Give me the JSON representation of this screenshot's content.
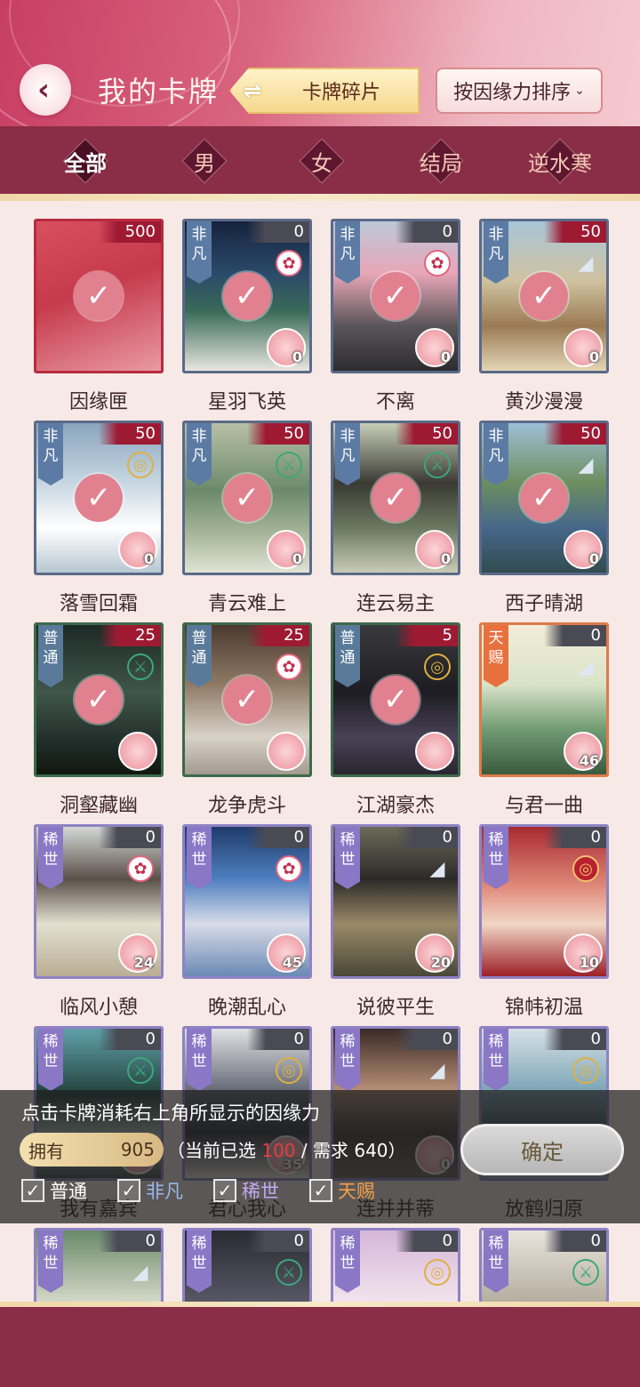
{
  "header": {
    "back_label": "‹",
    "title": "我的卡牌",
    "switch_label": "卡牌碎片",
    "sort_label": "按因缘力排序"
  },
  "tabs": [
    {
      "label": "全部",
      "active": true
    },
    {
      "label": "男"
    },
    {
      "label": "女"
    },
    {
      "label": "结局"
    },
    {
      "label": "逆水寒"
    }
  ],
  "cards": [
    {
      "name": "因缘匣",
      "cost": "500",
      "rarity": "",
      "elem": "",
      "selected": true,
      "owned": ""
    },
    {
      "name": "星羽飞英",
      "cost": "0",
      "rarity": "非凡",
      "elem": "flower",
      "selected": true,
      "owned": "0"
    },
    {
      "name": "不离",
      "cost": "0",
      "rarity": "非凡",
      "elem": "flower",
      "selected": true,
      "owned": "0"
    },
    {
      "name": "黄沙漫漫",
      "cost": "50",
      "rarity": "非凡",
      "elem": "fan",
      "selected": true,
      "owned": "0"
    },
    {
      "name": "落雪回霜",
      "cost": "50",
      "rarity": "非凡",
      "elem": "coin",
      "selected": true,
      "owned": "0"
    },
    {
      "name": "青云难上",
      "cost": "50",
      "rarity": "非凡",
      "elem": "sword",
      "selected": true,
      "owned": "0"
    },
    {
      "name": "连云易主",
      "cost": "50",
      "rarity": "非凡",
      "elem": "sword",
      "selected": true,
      "owned": "0"
    },
    {
      "name": "西子晴湖",
      "cost": "50",
      "rarity": "非凡",
      "elem": "fan",
      "selected": true,
      "owned": "0"
    },
    {
      "name": "洞壑藏幽",
      "cost": "25",
      "rarity": "普通",
      "elem": "sword",
      "selected": true,
      "owned": ""
    },
    {
      "name": "龙争虎斗",
      "cost": "25",
      "rarity": "普通",
      "elem": "flower",
      "selected": true,
      "owned": ""
    },
    {
      "name": "江湖豪杰",
      "cost": "5",
      "rarity": "普通",
      "elem": "coin",
      "selected": true,
      "owned": ""
    },
    {
      "name": "与君一曲",
      "cost": "0",
      "rarity": "天赐",
      "elem": "fan",
      "selected": false,
      "owned": "46"
    },
    {
      "name": "临风小憩",
      "cost": "0",
      "rarity": "稀世",
      "elem": "flower",
      "selected": false,
      "owned": "24"
    },
    {
      "name": "晚潮乱心",
      "cost": "0",
      "rarity": "稀世",
      "elem": "flower",
      "selected": false,
      "owned": "45"
    },
    {
      "name": "说彼平生",
      "cost": "0",
      "rarity": "稀世",
      "elem": "fan",
      "selected": false,
      "owned": "20"
    },
    {
      "name": "锦帏初温",
      "cost": "0",
      "rarity": "稀世",
      "elem": "coinred",
      "selected": false,
      "owned": "10"
    },
    {
      "name": "我有嘉宾",
      "cost": "0",
      "rarity": "稀世",
      "elem": "sword",
      "selected": false,
      "owned": ""
    },
    {
      "name": "君心我心",
      "cost": "0",
      "rarity": "稀世",
      "elem": "coin",
      "selected": false,
      "owned": "35"
    },
    {
      "name": "连并并蒂",
      "cost": "0",
      "rarity": "稀世",
      "elem": "fan",
      "selected": false,
      "owned": "0"
    },
    {
      "name": "放鹤归原",
      "cost": "0",
      "rarity": "稀世",
      "elem": "coin",
      "selected": false,
      "owned": ""
    },
    {
      "name": "",
      "cost": "0",
      "rarity": "稀世",
      "elem": "fan",
      "selected": false,
      "owned": ""
    },
    {
      "name": "",
      "cost": "0",
      "rarity": "稀世",
      "elem": "sword",
      "selected": false,
      "owned": ""
    },
    {
      "name": "",
      "cost": "0",
      "rarity": "稀世",
      "elem": "coin",
      "selected": false,
      "owned": ""
    },
    {
      "name": "",
      "cost": "0",
      "rarity": "稀世",
      "elem": "sword",
      "selected": false,
      "owned": ""
    }
  ],
  "overlay": {
    "hint": "点击卡牌消耗右上角所显示的因缘力",
    "own_label": "拥有",
    "own_value": "905",
    "status_prefix": "（当前已选",
    "selected_value": "100",
    "status_suffix": "/ 需求 640）",
    "confirm_label": "确定",
    "filters": [
      {
        "label": "普通",
        "color": "#ffffff",
        "checked": true
      },
      {
        "label": "非凡",
        "color": "#9bb9ef",
        "checked": true
      },
      {
        "label": "稀世",
        "color": "#c5a9f2",
        "checked": true
      },
      {
        "label": "天赐",
        "color": "#f0a04a",
        "checked": true
      }
    ]
  },
  "colors": {
    "accent": "#c83e63",
    "tab_bg": "#8a2e48",
    "check": "#e1818f",
    "cost_red": "#9e1a33"
  }
}
